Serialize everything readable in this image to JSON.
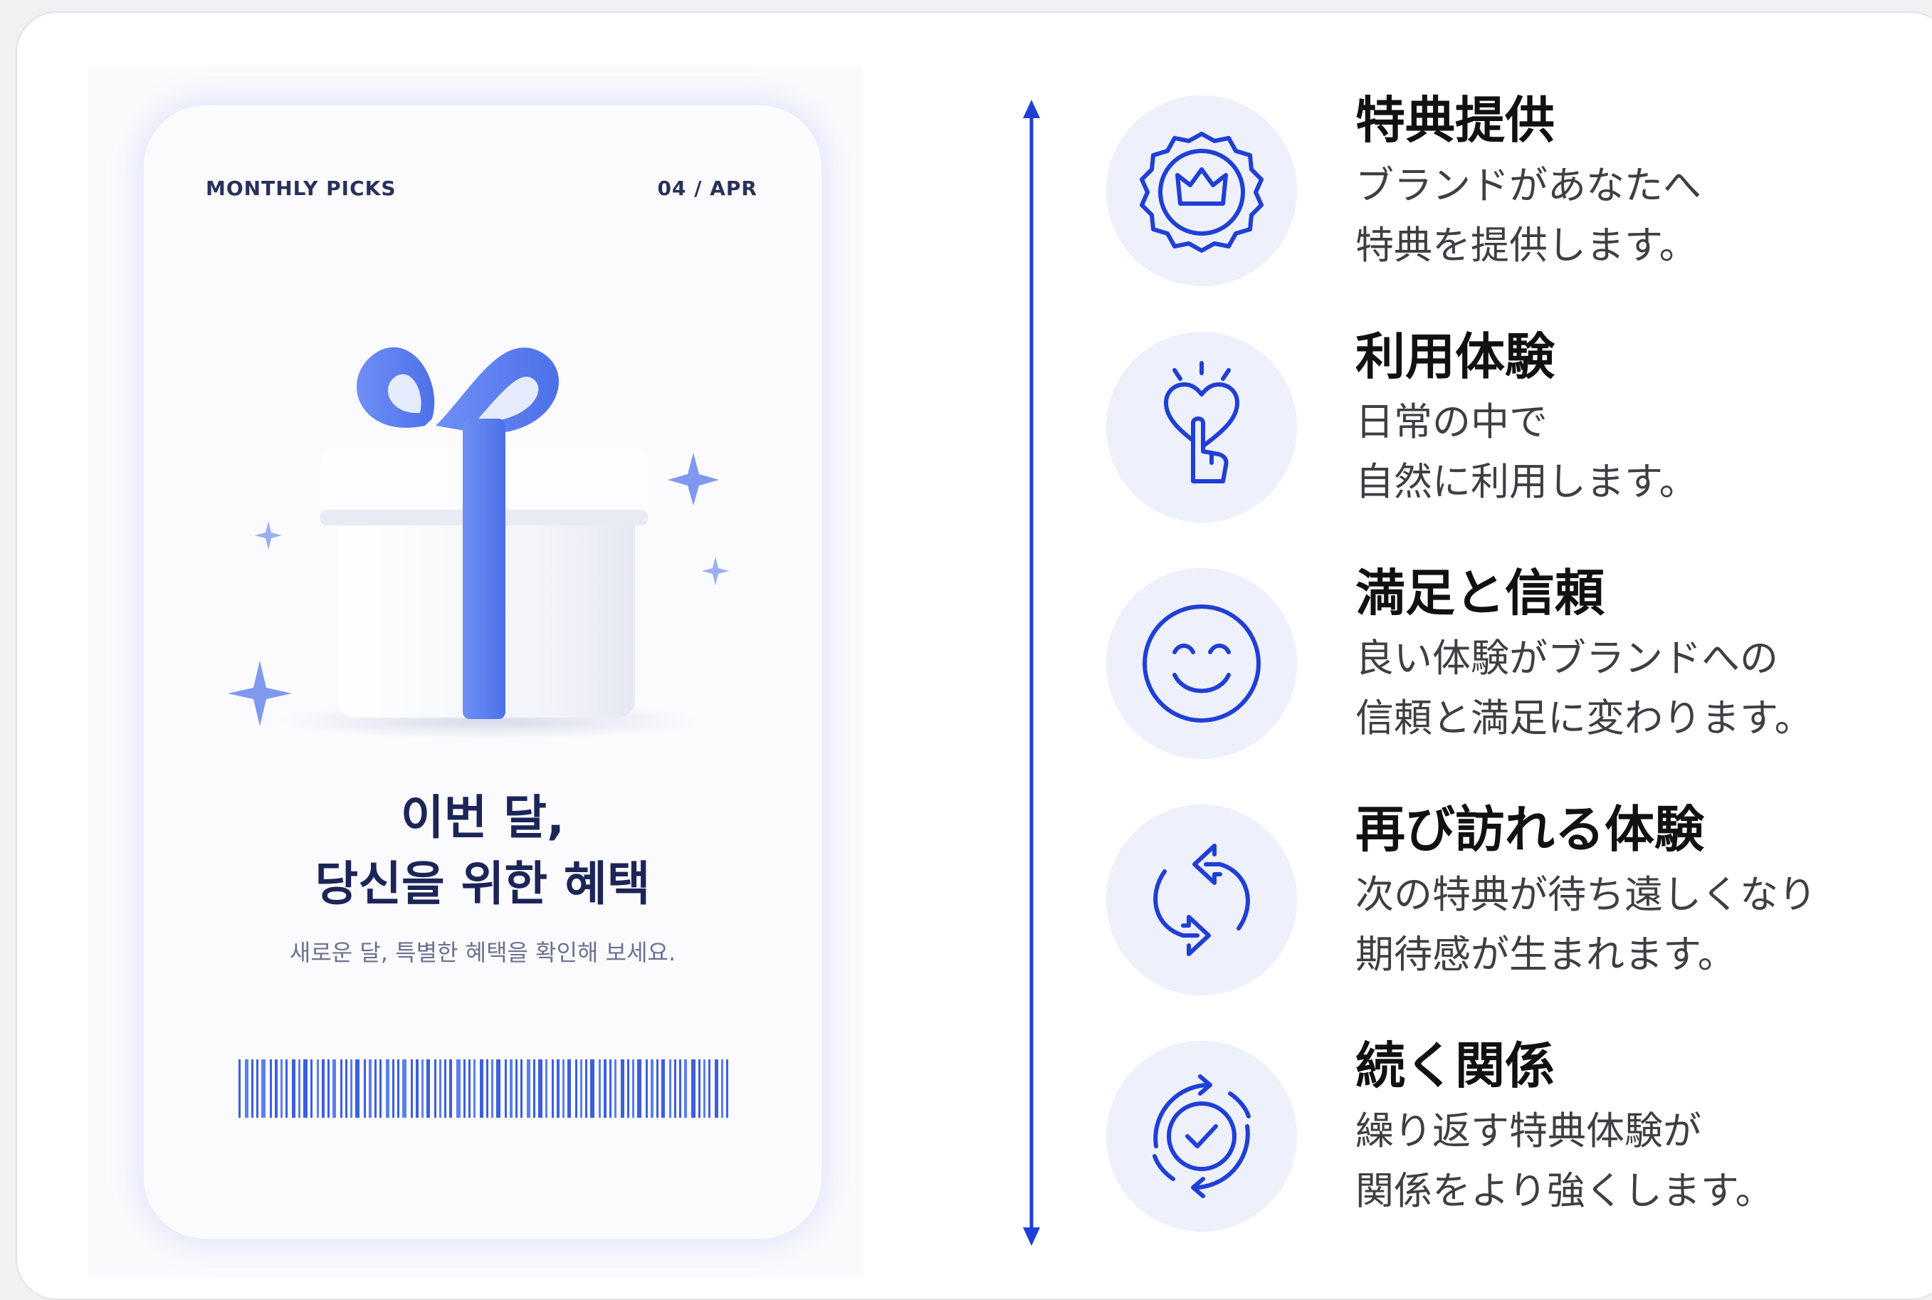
{
  "card": {
    "label_left": "MONTHLY PICKS",
    "label_right": "04 / APR",
    "headline_line1": "이번 달,",
    "headline_line2": "당신을 위한 혜택",
    "subline": "새로운 달, 특별한 혜택을 확인해 보세요."
  },
  "colors": {
    "accent": "#1f3fd6",
    "ribbon": "#5b7ff0",
    "headline": "#1b2558",
    "icon_bg": "#eef0fb"
  },
  "features": [
    {
      "icon": "crown-badge-icon",
      "title": "特典提供",
      "line1": "ブランドがあなたへ",
      "line2": "特典を提供します。"
    },
    {
      "icon": "heart-touch-icon",
      "title": "利用体験",
      "line1": "日常の中で",
      "line2": "自然に利用します。"
    },
    {
      "icon": "smile-icon",
      "title": "満足と信頼",
      "line1": "良い体験がブランドへの",
      "line2": "信頼と満足に変わります。"
    },
    {
      "icon": "refresh-arrows-icon",
      "title": "再び訪れる体験",
      "line1": "次の特典が待ち遠しくなり",
      "line2": "期待感が生まれます。"
    },
    {
      "icon": "cycle-check-icon",
      "title": "続く関係",
      "line1": "繰り返す特典体験が",
      "line2": "関係をより強くします。"
    }
  ]
}
